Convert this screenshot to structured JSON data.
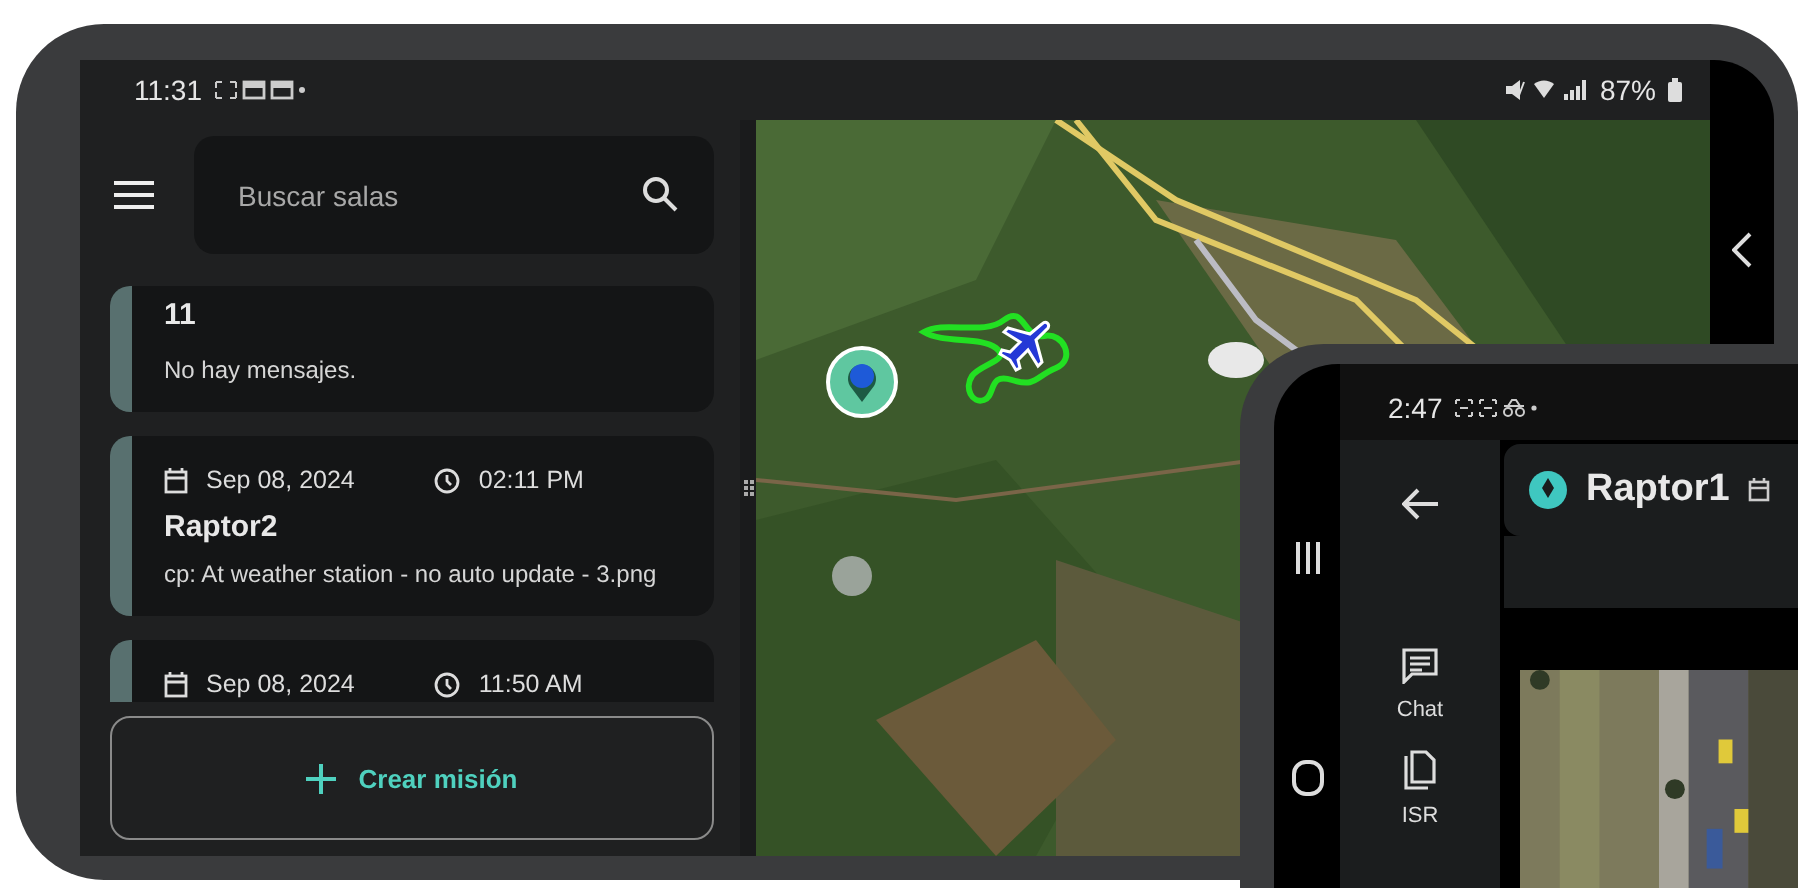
{
  "phone_main": {
    "status_bar": {
      "time": "11:31",
      "battery": "87%"
    },
    "search": {
      "placeholder": "Buscar salas"
    },
    "rooms": [
      {
        "title": "11",
        "message": "No hay mensajes."
      },
      {
        "date": "Sep 08, 2024",
        "time": "02:11 PM",
        "title": "Raptor2",
        "message": "cp: At weather station - no auto update - 3.png"
      },
      {
        "date": "Sep 08, 2024",
        "time": "11:50 AM"
      }
    ],
    "create_button": "Crear misión"
  },
  "phone_second": {
    "status_bar": {
      "time": "2:47"
    },
    "nav": [
      {
        "label": "Chat",
        "kind": "chat"
      },
      {
        "label": "ISR",
        "kind": "isr"
      }
    ],
    "header": {
      "title": "Raptor1"
    }
  }
}
